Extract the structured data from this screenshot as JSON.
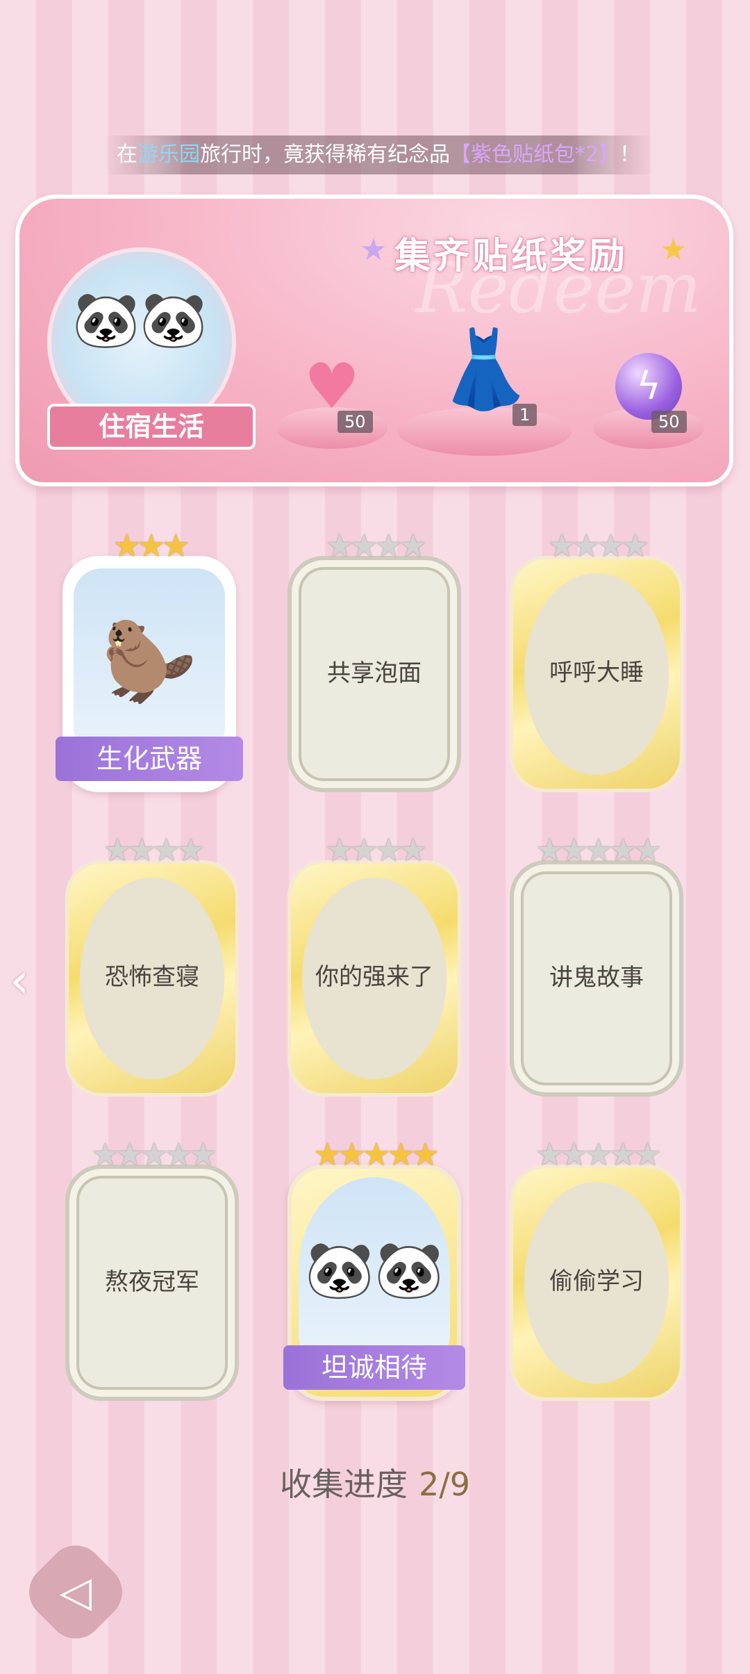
{
  "notice": {
    "prefix": "在",
    "location": "游乐园",
    "middle": "旅行时，竟获得稀有纪念品",
    "item": "【紫色贴纸包*2】",
    "suffix": "！"
  },
  "banner": {
    "title": "集齐贴纸奖励",
    "watermark": "Redeem",
    "album_label": "住宿生活",
    "rewards": [
      {
        "icon": "pink-heart-gem-icon",
        "count": "50"
      },
      {
        "icon": "dress-outfit-icon",
        "count": "1"
      },
      {
        "icon": "purple-energy-orb-icon",
        "count": "50"
      }
    ]
  },
  "stickers": [
    {
      "label": "生化武器",
      "unlocked": true,
      "stars": 3,
      "max_stars": 3,
      "frame": "unlocked"
    },
    {
      "label": "共享泡面",
      "unlocked": false,
      "stars": 0,
      "max_stars": 4,
      "frame": "silver"
    },
    {
      "label": "呼呼大睡",
      "unlocked": false,
      "stars": 0,
      "max_stars": 4,
      "frame": "gold"
    },
    {
      "label": "恐怖查寝",
      "unlocked": false,
      "stars": 0,
      "max_stars": 4,
      "frame": "gold"
    },
    {
      "label": "你的强来了",
      "unlocked": false,
      "stars": 0,
      "max_stars": 4,
      "frame": "gold"
    },
    {
      "label": "讲鬼故事",
      "unlocked": false,
      "stars": 0,
      "max_stars": 5,
      "frame": "silver"
    },
    {
      "label": "熬夜冠军",
      "unlocked": false,
      "stars": 0,
      "max_stars": 5,
      "frame": "silver"
    },
    {
      "label": "坦诚相待",
      "unlocked": true,
      "stars": 5,
      "max_stars": 5,
      "frame": "unlocked"
    },
    {
      "label": "偷偷学习",
      "unlocked": false,
      "stars": 0,
      "max_stars": 5,
      "frame": "gold"
    }
  ],
  "progress": {
    "label": "收集进度",
    "value": "2/9"
  },
  "nav": {
    "prev_icon": "chevron-left-icon",
    "back_icon": "back-arrow-icon"
  }
}
